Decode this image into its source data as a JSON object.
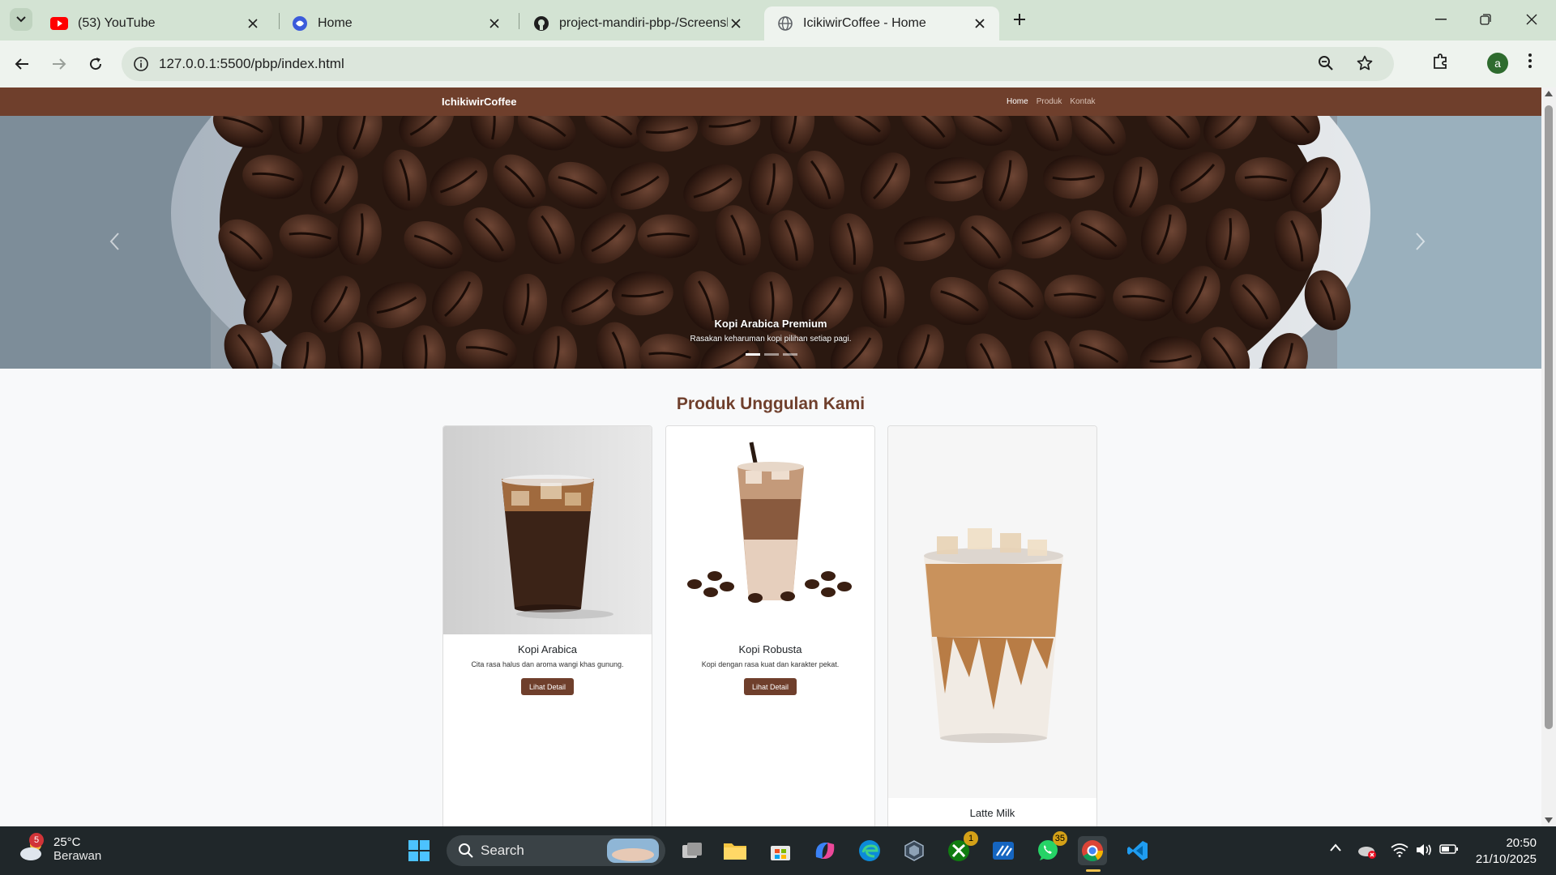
{
  "browser": {
    "tabs": [
      {
        "title": "(53) YouTube",
        "icon": "youtube-icon",
        "active": false
      },
      {
        "title": "Home",
        "icon": "site-favicon-icon",
        "active": false
      },
      {
        "title": "project-mandiri-pbp-/Screensh",
        "icon": "github-icon",
        "active": false
      },
      {
        "title": "IcikiwirCoffee - Home",
        "icon": "globe-icon",
        "active": true
      }
    ],
    "url": "127.0.0.1:5500/pbp/index.html",
    "profile_initial": "a"
  },
  "site": {
    "brand": "IchikiwirCoffee",
    "nav": [
      "Home",
      "Produk",
      "Kontak"
    ],
    "hero": {
      "caption_title": "Kopi Arabica Premium",
      "caption_text": "Rasakan keharuman kopi pilihan setiap pagi.",
      "slides": 3,
      "active_slide": 0
    },
    "section_title": "Produk Unggulan Kami",
    "products": [
      {
        "name": "Kopi Arabica",
        "desc": "Cita rasa halus dan aroma wangi khas gunung.",
        "button": "Lihat Detail"
      },
      {
        "name": "Kopi Robusta",
        "desc": "Kopi dengan rasa kuat dan karakter pekat.",
        "button": "Lihat Detail"
      },
      {
        "name": "Latte Milk",
        "desc": "",
        "button": ""
      }
    ],
    "colors": {
      "brand": "#6f3f2c",
      "navbar": "#6f3f2c"
    }
  },
  "taskbar": {
    "weather_temp": "25°C",
    "weather_cond": "Berawan",
    "weather_badge": "5",
    "search_label": "Search",
    "xbox_badge": "1",
    "whatsapp_badge": "35",
    "time": "20:50",
    "date": "21/10/2025"
  }
}
